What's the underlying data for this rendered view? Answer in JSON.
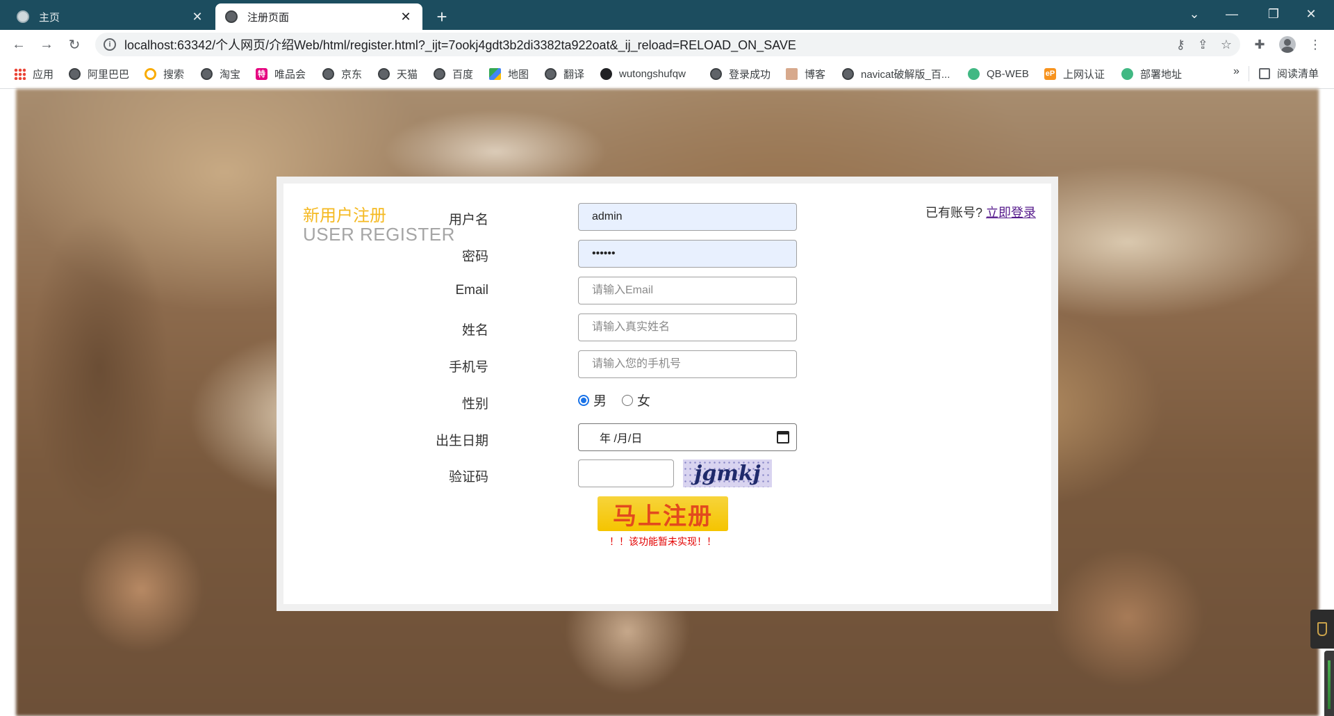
{
  "browser": {
    "tabs": [
      {
        "title": "主页",
        "active": false
      },
      {
        "title": "注册页面",
        "active": true
      }
    ],
    "url": "localhost:63342/个人网页/介绍Web/html/register.html?_ijt=7ookj4gdt3b2di3382ta922oat&_ij_reload=RELOAD_ON_SAVE",
    "bookmarks": [
      {
        "label": "应用",
        "icon": "apps-grid-icon"
      },
      {
        "label": "阿里巴巴",
        "icon": "globe-icon"
      },
      {
        "label": "搜索",
        "icon": "search-icon"
      },
      {
        "label": "淘宝",
        "icon": "globe-icon"
      },
      {
        "label": "唯品会",
        "icon": "vip-icon"
      },
      {
        "label": "京东",
        "icon": "globe-icon"
      },
      {
        "label": "天猫",
        "icon": "globe-icon"
      },
      {
        "label": "百度",
        "icon": "globe-icon"
      },
      {
        "label": "地图",
        "icon": "map-icon"
      },
      {
        "label": "翻译",
        "icon": "globe-icon"
      },
      {
        "label": "wutongshufqw",
        "icon": "github-icon"
      },
      {
        "label": "登录成功",
        "icon": "globe-icon"
      },
      {
        "label": "博客",
        "icon": "blog-icon"
      },
      {
        "label": "navicat破解版_百...",
        "icon": "globe-icon"
      },
      {
        "label": "QB-WEB",
        "icon": "vue-icon"
      },
      {
        "label": "上网认证",
        "icon": "ep-icon"
      },
      {
        "label": "部署地址",
        "icon": "vue-icon"
      }
    ],
    "bookmarks_more": "»",
    "reading_list": "阅读清单"
  },
  "register": {
    "heading_cn": "新用户注册",
    "heading_en": "USER REGISTER",
    "login_prompt": "已有账号?",
    "login_link": "立即登录",
    "labels": {
      "username": "用户名",
      "password": "密码",
      "email": "Email",
      "realname": "姓名",
      "phone": "手机号",
      "gender": "性别",
      "birthday": "出生日期",
      "captcha": "验证码"
    },
    "values": {
      "username": "admin",
      "password": "••••••",
      "email": "",
      "realname": "",
      "phone": ""
    },
    "placeholders": {
      "email": "请输入Email",
      "realname": "请输入真实姓名",
      "phone": "请输入您的手机号"
    },
    "gender_options": [
      {
        "label": "男",
        "checked": true
      },
      {
        "label": "女",
        "checked": false
      }
    ],
    "birthday_value": "年 /月/日",
    "captcha_text": "jgmkj",
    "submit_label": "马上注册",
    "note": "！！该功能暂未实现！！"
  },
  "colors": {
    "titlebar": "#1c4d5f",
    "heading_cn": "#f5b921",
    "heading_en": "#a5a5a5",
    "submit_bg": "#f5c400",
    "submit_text": "#e24a1e",
    "note": "#e30000",
    "autofill_bg": "#e8f0fe"
  }
}
